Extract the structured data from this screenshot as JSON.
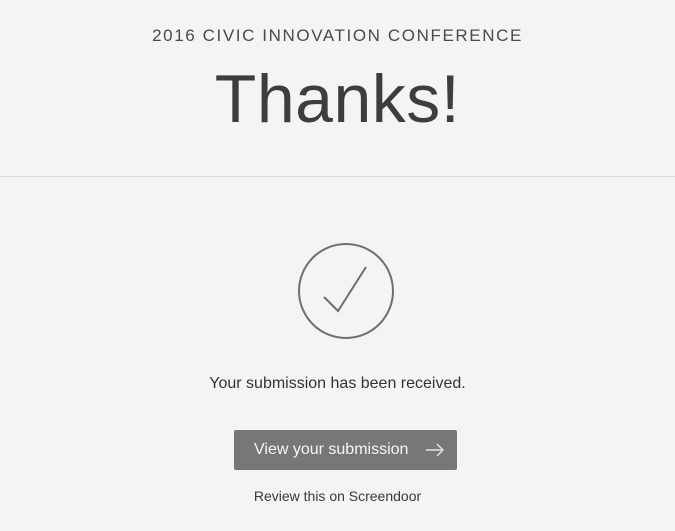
{
  "header": {
    "eyebrow": "2016 CIVIC INNOVATION CONFERENCE",
    "title": "Thanks!"
  },
  "confirmation": {
    "icon": "checkmark-circle-icon",
    "message": "Your submission has been received."
  },
  "actions": {
    "view_label": "View your submission",
    "view_icon": "arrow-right-icon",
    "review_link": "Review this on Screendoor"
  },
  "colors": {
    "background": "#f4f4f4",
    "button": "#777777",
    "text": "#3a3a3a"
  }
}
